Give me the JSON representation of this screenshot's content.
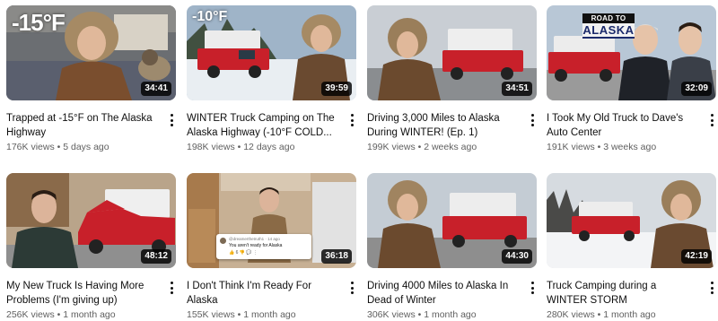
{
  "videos": [
    {
      "title": "Trapped at -15°F on The Alaska Highway",
      "views": "176K views",
      "age": "5 days ago",
      "duration": "34:41",
      "overlay": "-15°F"
    },
    {
      "title": "WINTER Truck Camping on The Alaska Highway (-10°F COLD...",
      "views": "198K views",
      "age": "12 days ago",
      "duration": "39:59",
      "overlay": "-10°F"
    },
    {
      "title": "Driving 3,000 Miles to Alaska During WINTER! (Ep. 1)",
      "views": "199K views",
      "age": "2 weeks ago",
      "duration": "34:51"
    },
    {
      "title": "I Took My Old Truck to Dave's Auto Center",
      "views": "191K views",
      "age": "3 weeks ago",
      "duration": "32:09",
      "badge_small": "ROAD TO",
      "badge_big": "ALASKA"
    },
    {
      "title": "My New Truck Is Having More Problems (I'm giving up)",
      "views": "256K views",
      "age": "1 month ago",
      "duration": "48:12"
    },
    {
      "title": "I Don't Think I'm Ready For Alaska",
      "views": "155K views",
      "age": "1 month ago",
      "duration": "36:18",
      "comment_user": "@dreamerthetruth1 · 14 ago",
      "comment_text": "You aren't ready for Alaska",
      "comment_actions": "👍 6 👎 💬 ⋮"
    },
    {
      "title": "Driving 4000 Miles to Alaska In Dead of Winter",
      "views": "306K views",
      "age": "1 month ago",
      "duration": "44:30"
    },
    {
      "title": "Truck Camping during a WINTER STORM",
      "views": "280K views",
      "age": "1 month ago",
      "duration": "42:19"
    }
  ],
  "separator": " • ",
  "colors": {
    "truck_red": "#c8202a",
    "camper_white": "#f3f3f3",
    "duration_bg": "#000000",
    "meta_text": "#606060"
  }
}
